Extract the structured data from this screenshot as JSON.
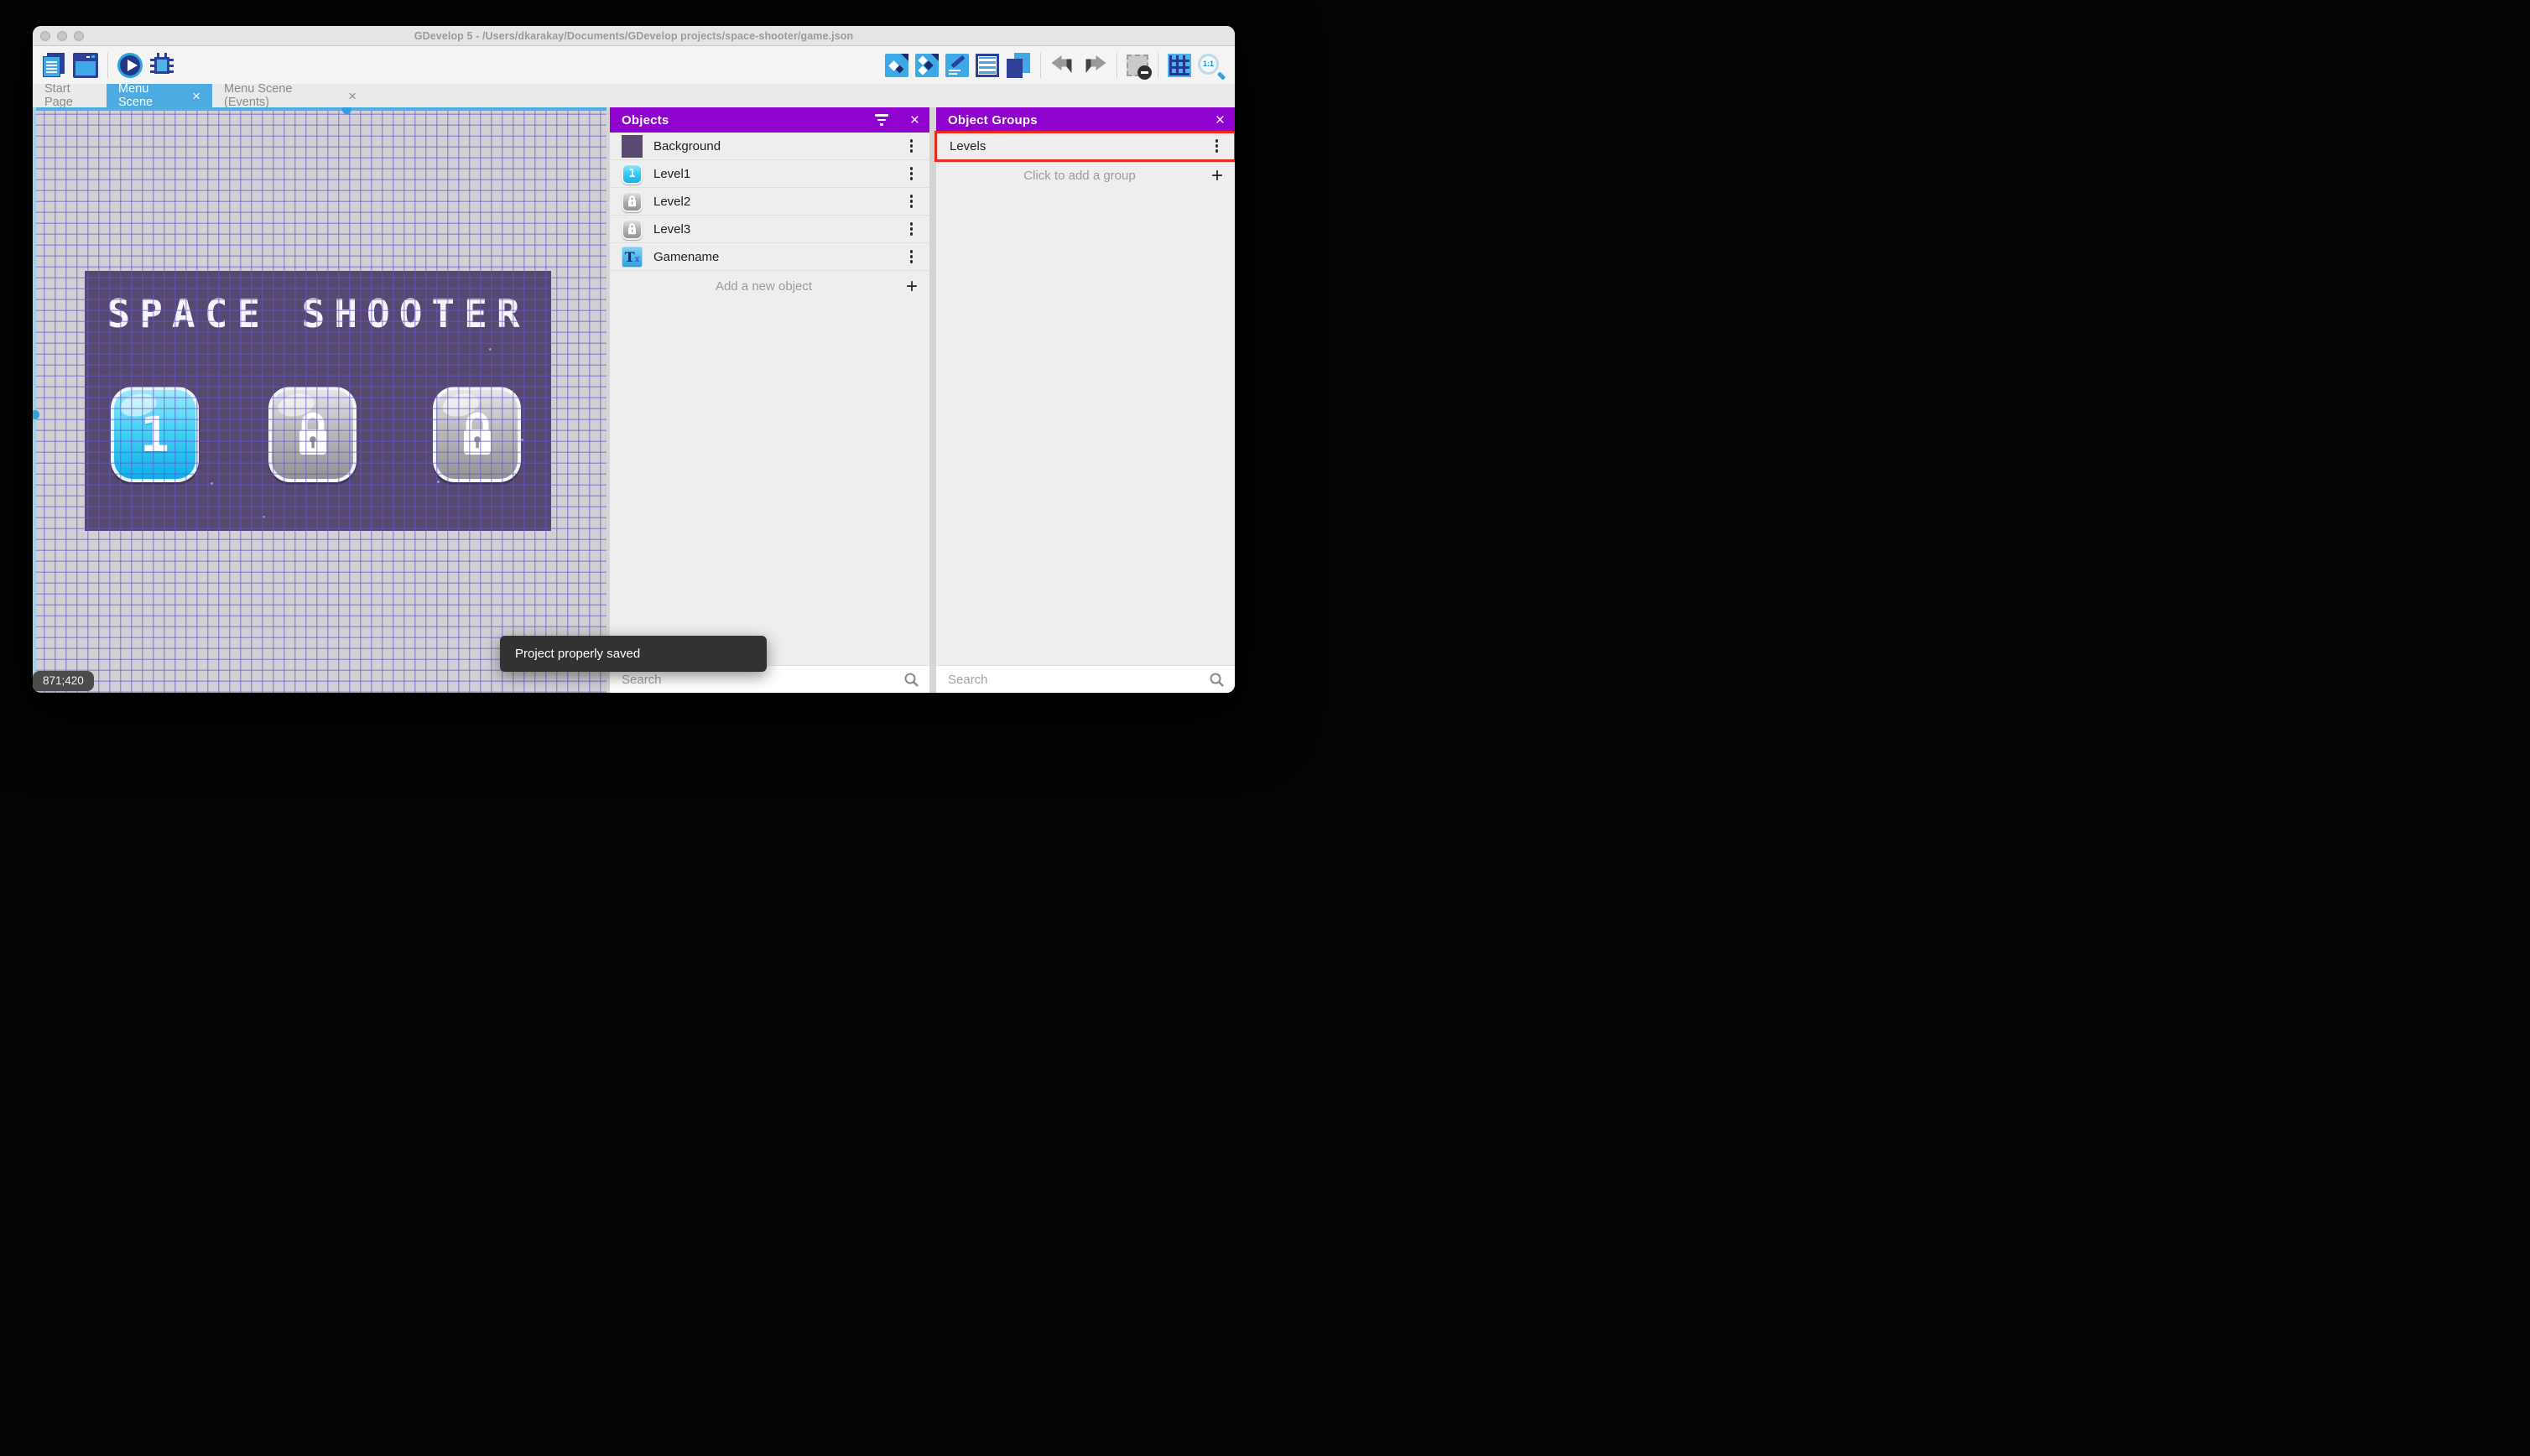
{
  "window": {
    "title": "GDevelop 5 - /Users/dkarakay/Documents/GDevelop projects/space-shooter/game.json"
  },
  "tabs": {
    "start_page": "Start Page",
    "scene": "Menu Scene",
    "events": "Menu Scene (Events)"
  },
  "glyphs": {
    "close": "×",
    "plus": "+"
  },
  "canvas": {
    "scene_title": "SPACE SHOOTER",
    "level_button_1_label": "1",
    "coordinates": "871;420",
    "toast": "Project properly saved"
  },
  "objects_panel": {
    "title": "Objects",
    "items": [
      {
        "label": "Background",
        "icon": "purple-color-swatch"
      },
      {
        "label": "Level1",
        "icon": "blue-level-button"
      },
      {
        "label": "Level2",
        "icon": "locked-level-button"
      },
      {
        "label": "Level3",
        "icon": "locked-level-button"
      },
      {
        "label": "Gamename",
        "icon": "text-object"
      }
    ],
    "add_label": "Add a new object",
    "search_placeholder": "Search"
  },
  "object_groups_panel": {
    "title": "Object Groups",
    "items": [
      {
        "label": "Levels",
        "highlighted": true
      }
    ],
    "add_label": "Click to add a group",
    "search_placeholder": "Search"
  },
  "colors": {
    "accent_purple": "#9002ce",
    "active_tab_blue": "#4dabe2",
    "highlight_red": "#ee2b16",
    "scene_purple": "#57486f"
  }
}
